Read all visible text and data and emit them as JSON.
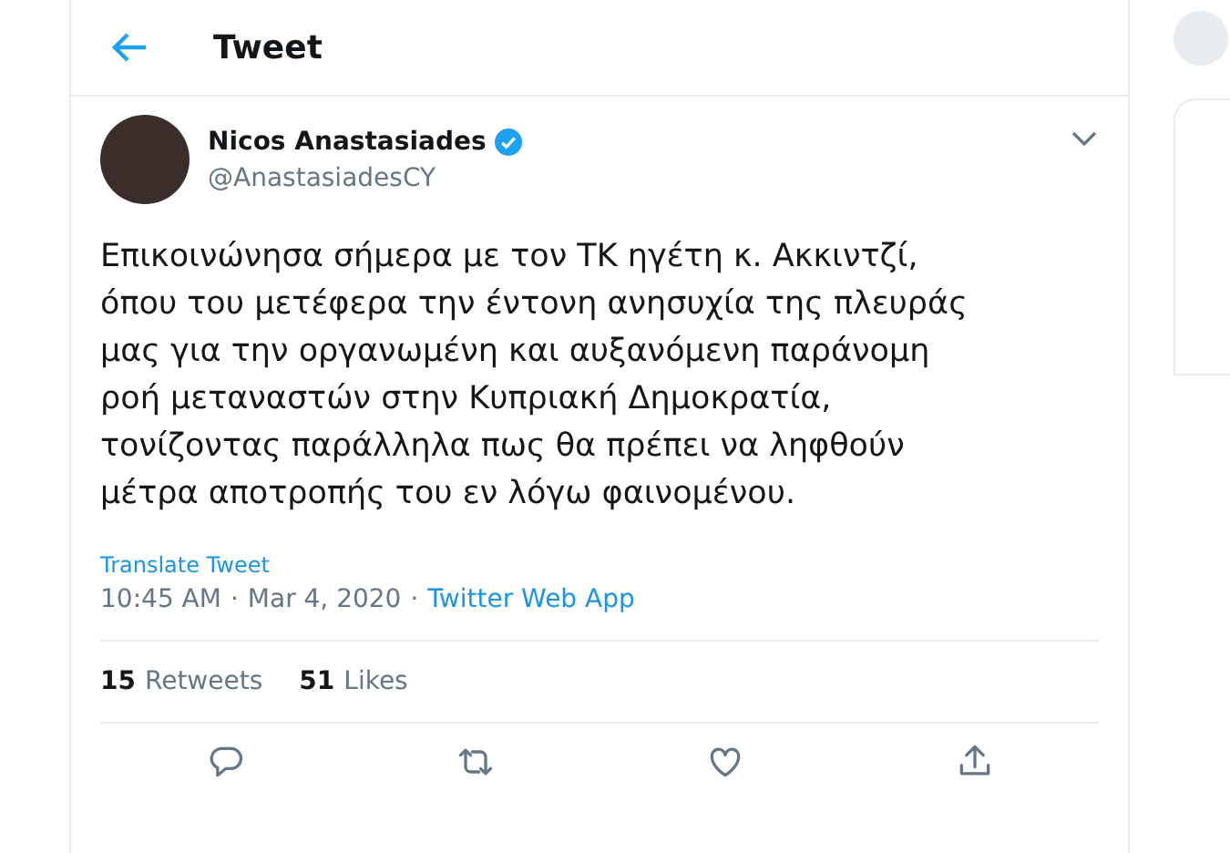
{
  "header": {
    "title": "Tweet"
  },
  "author": {
    "name": "Nicos Anastasiades",
    "verified": true,
    "handle": "@AnastasiadesCY"
  },
  "text": "Επικοινώνησα σήμερα με τον ΤΚ ηγέτη κ. Ακκιντζί,\nόπου του μετέφερα την έντονη ανησυχία της πλευράς\nμας για την οργανωμένη και αυξανόμενη παράνομη\nροή μεταναστών στην Κυπριακή Δημοκρατία,\nτονίζοντας παράλληλα πως θα πρέπει να ληφθούν\nμέτρα αποτροπής του εν λόγω φαινομένου.",
  "translate": "Translate Tweet",
  "meta": {
    "time": "10:45 AM",
    "separator_1": "·",
    "date": "Mar 4, 2020",
    "separator_2": "·",
    "source": "Twitter Web App"
  },
  "stats": [
    {
      "count": "15",
      "label": "Retweets"
    },
    {
      "count": "51",
      "label": "Likes"
    }
  ],
  "actions": [
    {
      "kind": "reply"
    },
    {
      "kind": "retweet"
    },
    {
      "kind": "like"
    },
    {
      "kind": "share"
    }
  ]
}
